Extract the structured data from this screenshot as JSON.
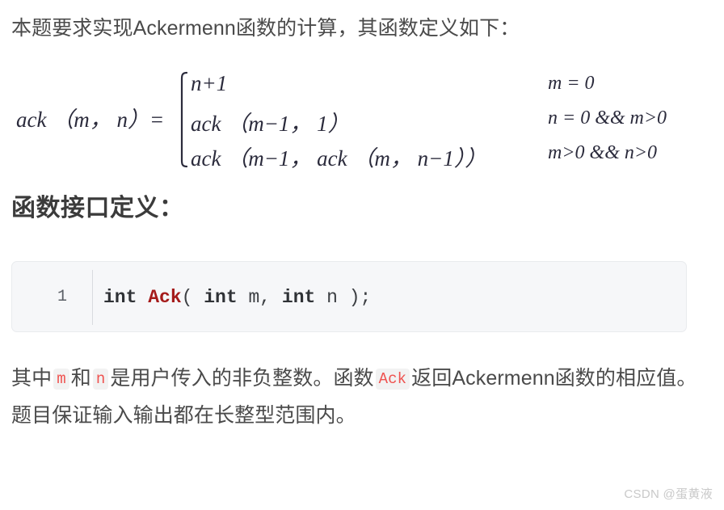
{
  "intro": {
    "text": "本题要求实现Ackermenn函数的计算，其函数定义如下："
  },
  "formula": {
    "lhs": "ack （m， n）=",
    "cases": [
      {
        "expr": "n+1",
        "cond": "m = 0"
      },
      {
        "expr": "ack （m−1， 1）",
        "cond": "n = 0 && m>0"
      },
      {
        "expr": "ack （m−1， ack （m， n−1））",
        "cond": "m>0 && n>0"
      }
    ]
  },
  "heading": {
    "text": "函数接口定义："
  },
  "code": {
    "line_number": "1",
    "tokens": [
      {
        "text": "int ",
        "type": "keyword"
      },
      {
        "text": "Ack",
        "type": "function"
      },
      {
        "text": "( ",
        "type": "punct"
      },
      {
        "text": "int ",
        "type": "keyword"
      },
      {
        "text": "m",
        "type": "param"
      },
      {
        "text": ", ",
        "type": "punct"
      },
      {
        "text": "int ",
        "type": "keyword"
      },
      {
        "text": "n ",
        "type": "param"
      },
      {
        "text": ");",
        "type": "punct"
      }
    ],
    "plain": "int Ack( int m, int n );",
    "keyword_color": "#2f3236",
    "function_color": "#a51b1b",
    "background": "#f6f7f9"
  },
  "body": {
    "segments": [
      {
        "text": "其中",
        "type": "text"
      },
      {
        "text": "m",
        "type": "code"
      },
      {
        "text": "和",
        "type": "text"
      },
      {
        "text": "n",
        "type": "code"
      },
      {
        "text": "是用户传入的非负整数。函数",
        "type": "text"
      },
      {
        "text": "Ack",
        "type": "code"
      },
      {
        "text": "返回Ackermenn函数的相应值。题目保证输入输出都在长整型范围内。",
        "type": "text"
      }
    ],
    "inline_code_color": "#ef5350",
    "inline_code_bg": "#f2f2f2"
  },
  "watermark": {
    "text": "CSDN @蛋黄液"
  }
}
